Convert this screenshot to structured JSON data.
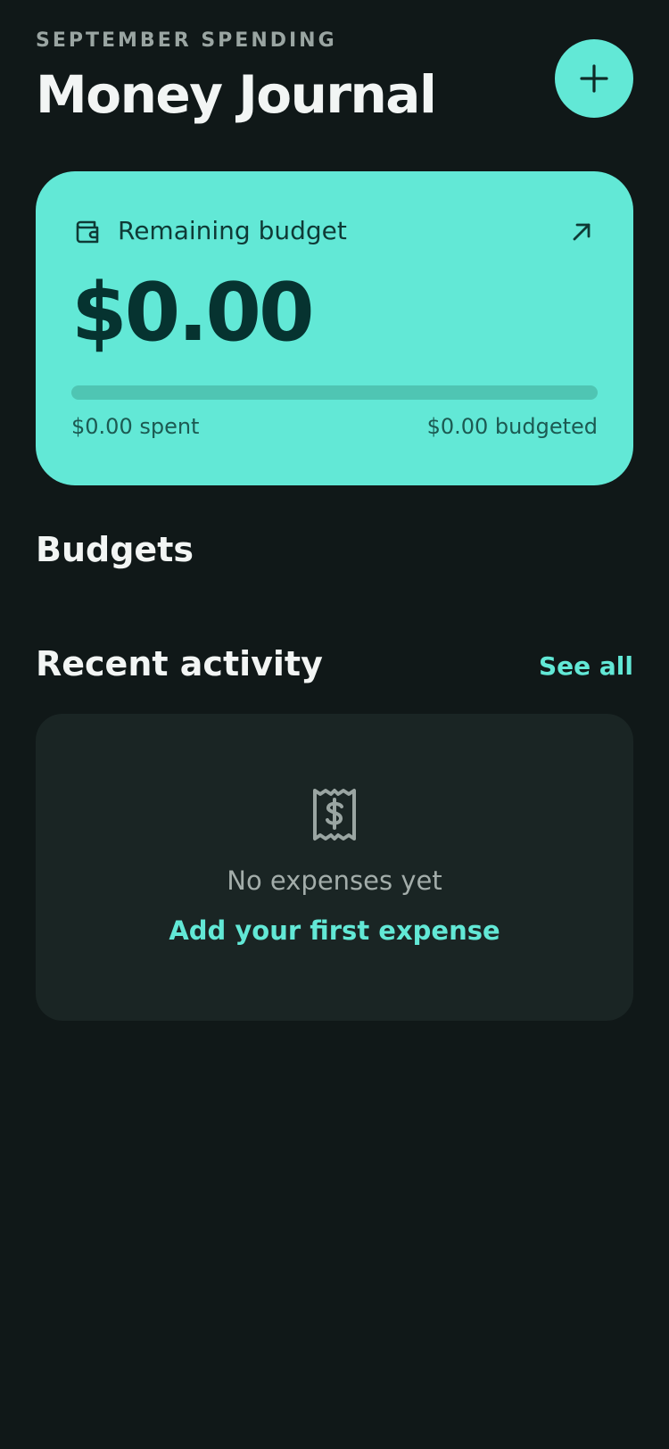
{
  "header": {
    "eyebrow": "SEPTEMBER SPENDING",
    "title": "Money Journal",
    "add_icon": "plus-icon"
  },
  "budget_card": {
    "label": "Remaining budget",
    "amount": "$0.00",
    "spent_label": "$0.00 spent",
    "budgeted_label": "$0.00 budgeted",
    "progress_fraction": 0,
    "wallet_icon": "wallet-icon",
    "open_icon": "arrow-up-right-icon"
  },
  "budgets": {
    "title": "Budgets"
  },
  "recent_activity": {
    "title": "Recent activity",
    "see_all": "See all",
    "empty_icon": "receipt-dollar-icon",
    "empty_text": "No expenses yet",
    "empty_action": "Add your first expense"
  },
  "colors": {
    "background": "#101818",
    "accent": "#62e8d6",
    "card_dark": "#1a2524",
    "text_primary": "#f2f5f4",
    "text_muted": "#9aa5a2",
    "accent_text_dark": "#063330"
  }
}
